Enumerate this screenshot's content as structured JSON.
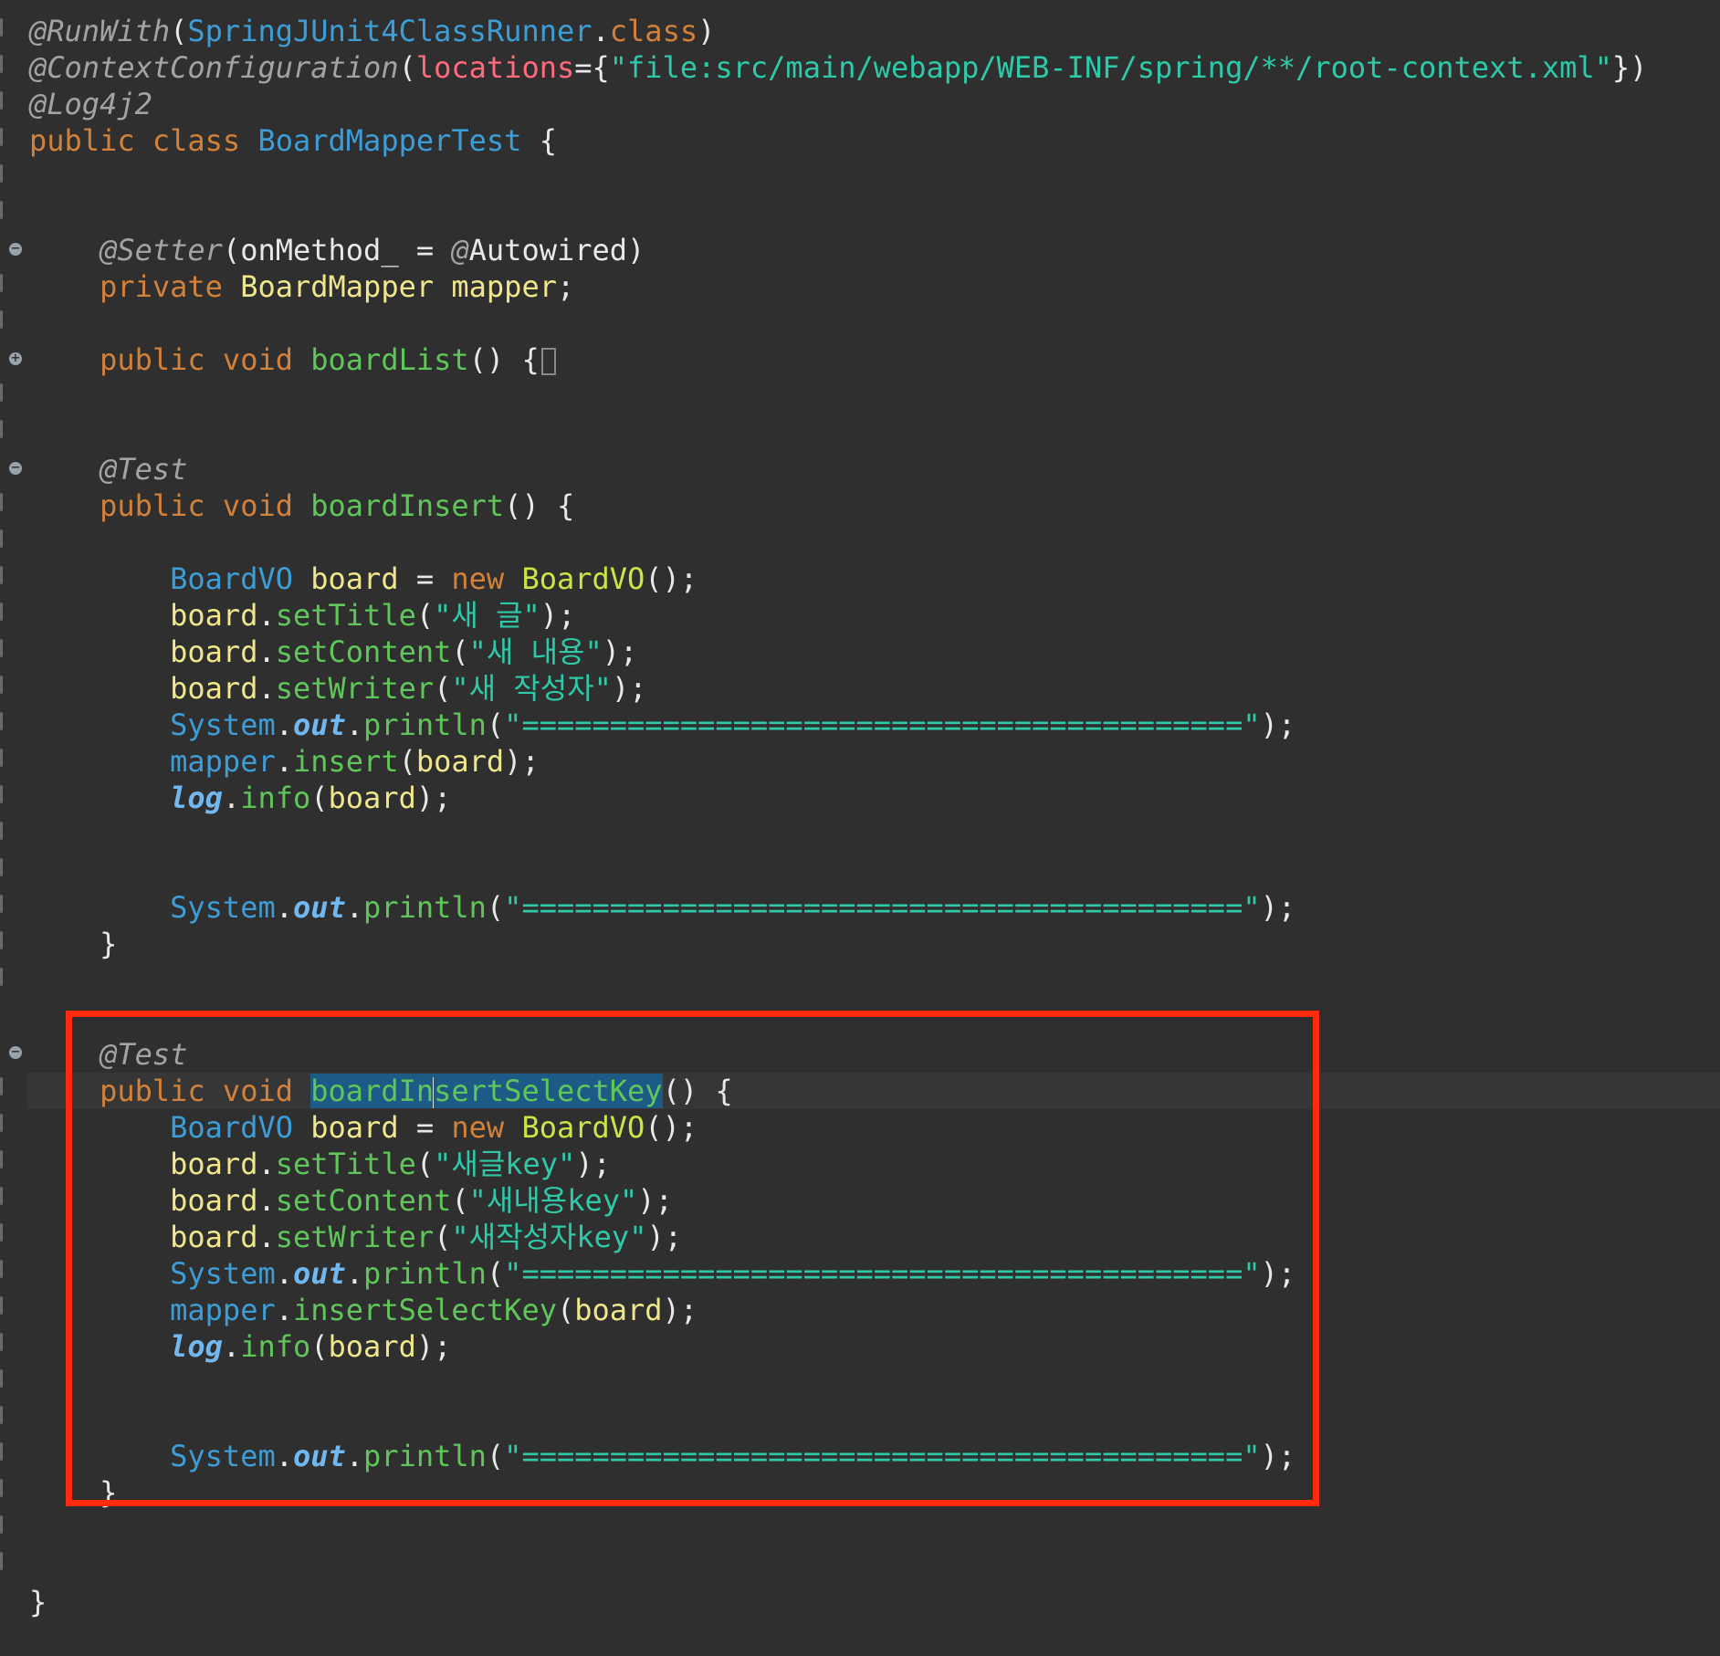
{
  "colors": {
    "background": "#2f2f2f",
    "annotation_box": "#ff2a0f",
    "keyword": "#d2813a",
    "type": "#3d9dd6",
    "method": "#5fc75a",
    "variable": "#f0e68c",
    "string": "#2ec9a8",
    "annotation": "#a3a3a3",
    "selection": "#1d5a86"
  },
  "code": {
    "runwith_ann": "@RunWith",
    "runwith_arg_type": "SpringJUnit4ClassRunner",
    "runwith_arg_class": "class",
    "ctxcfg_ann": "@ContextConfiguration",
    "ctxcfg_attr": "locations",
    "ctxcfg_value": "\"file:src/main/webapp/WEB-INF/spring/**/root-context.xml\"",
    "log4j2_ann": "@Log4j2",
    "kw_public": "public",
    "kw_class": "class",
    "kw_private": "private",
    "kw_void": "void",
    "kw_new": "new",
    "class_name": "BoardMapperTest",
    "setter_ann": "@Setter",
    "setter_arg": "onMethod_",
    "autowired_at": "@",
    "autowired": "Autowired",
    "mapper_type": "BoardMapper",
    "mapper_var": "mapper",
    "m_boardList": "boardList",
    "test_ann": "@Test",
    "m_boardInsert": "boardInsert",
    "vo_type": "BoardVO",
    "board_var": "board",
    "setTitle": "setTitle",
    "setContent": "setContent",
    "setWriter": "setWriter",
    "system": "System",
    "out": "out",
    "println": "println",
    "equals_str": "\"=========================================\"",
    "insert": "insert",
    "log": "log",
    "info": "info",
    "str_title1": "\"새 글\"",
    "str_content1": "\"새 내용\"",
    "str_writer1": "\"새 작성자\"",
    "m2_part1": "boardIn",
    "m2_part2": "sertSelectKey",
    "str_title2": "\"새글key\"",
    "str_content2": "\"새내용key\"",
    "str_writer2": "\"새작성자key\"",
    "insertSelectKey": "insertSelectKey"
  }
}
